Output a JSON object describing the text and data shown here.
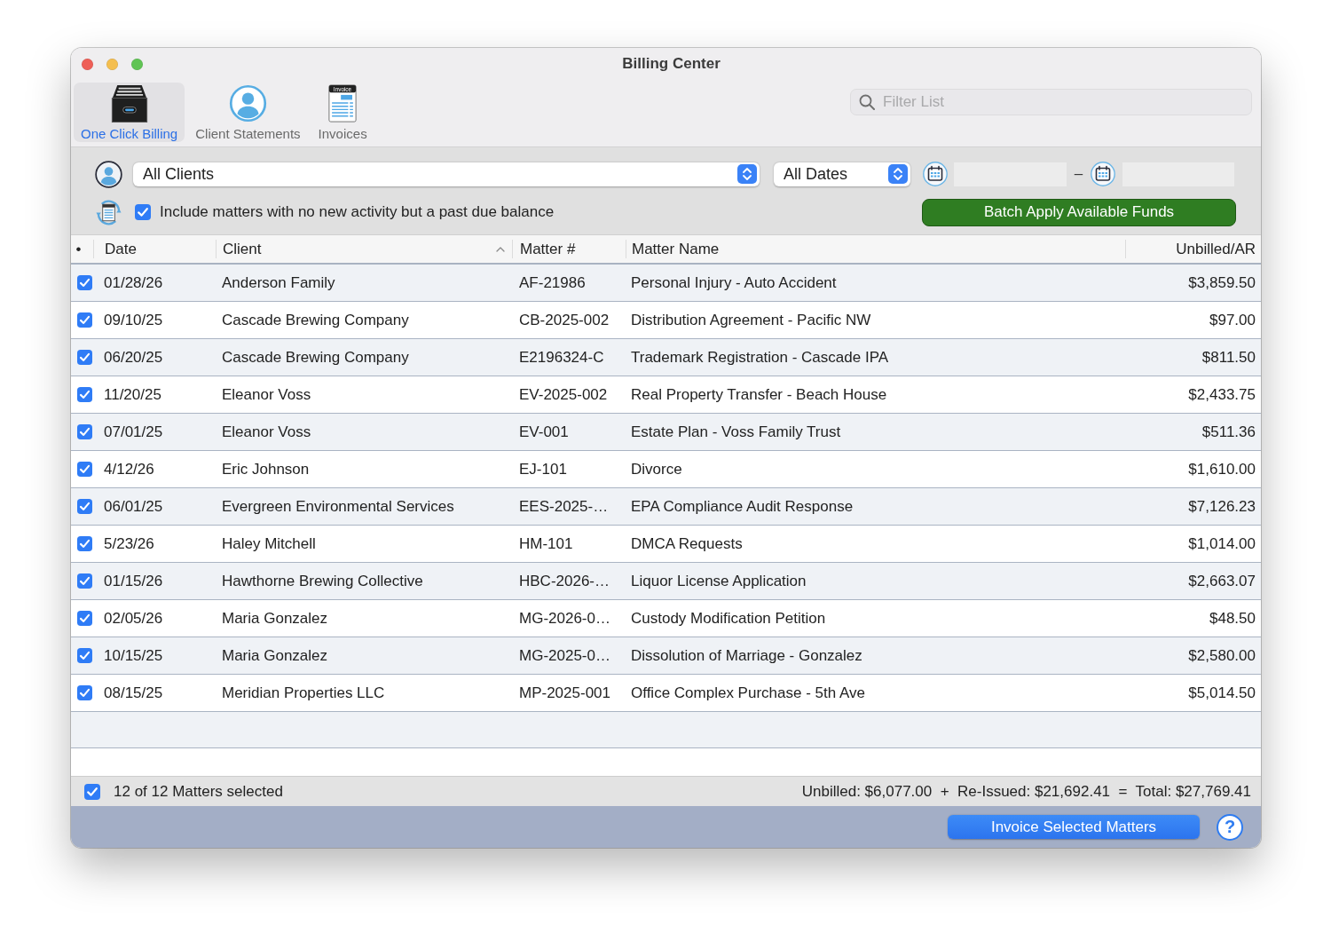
{
  "window": {
    "title": "Billing Center"
  },
  "toolbar": {
    "tabs": [
      {
        "label": "One Click Billing",
        "kind": "drawer",
        "selected": true
      },
      {
        "label": "Client Statements",
        "kind": "person",
        "selected": false
      },
      {
        "label": "Invoices",
        "kind": "invoice",
        "icon_text": "Invoice",
        "selected": false
      }
    ],
    "search": {
      "placeholder": "Filter List"
    }
  },
  "filters": {
    "client_popup": {
      "value": "All Clients"
    },
    "date_popup": {
      "value": "All Dates"
    },
    "date_separator": "–",
    "include_past_due": {
      "label": "Include matters with no new activity but a past due balance",
      "checked": true
    },
    "batch_button": "Batch Apply Available Funds"
  },
  "table": {
    "columns": [
      {
        "label": "•",
        "sorted": false
      },
      {
        "label": "Date",
        "sorted": false
      },
      {
        "label": "Client",
        "sorted": true
      },
      {
        "label": "Matter #",
        "sorted": false
      },
      {
        "label": "Matter Name",
        "sorted": false
      },
      {
        "label": "Unbilled/AR",
        "sorted": false
      }
    ],
    "rows": [
      {
        "checked": true,
        "date": "01/28/26",
        "client": "Anderson Family",
        "matter_number": "AF-21986",
        "matter_name": "Personal Injury - Auto Accident",
        "unbilled_ar": "$3,859.50"
      },
      {
        "checked": true,
        "date": "09/10/25",
        "client": "Cascade Brewing Company",
        "matter_number": "CB-2025-002",
        "matter_name": "Distribution Agreement - Pacific NW",
        "unbilled_ar": "$97.00"
      },
      {
        "checked": true,
        "date": "06/20/25",
        "client": "Cascade Brewing Company",
        "matter_number": "E2196324-C",
        "matter_name": "Trademark Registration - Cascade IPA",
        "unbilled_ar": "$811.50"
      },
      {
        "checked": true,
        "date": "11/20/25",
        "client": "Eleanor Voss",
        "matter_number": "EV-2025-002",
        "matter_name": "Real Property Transfer - Beach House",
        "unbilled_ar": "$2,433.75"
      },
      {
        "checked": true,
        "date": "07/01/25",
        "client": "Eleanor Voss",
        "matter_number": "EV-001",
        "matter_name": "Estate Plan - Voss Family Trust",
        "unbilled_ar": "$511.36"
      },
      {
        "checked": true,
        "date": "4/12/26",
        "client": "Eric Johnson",
        "matter_number": "EJ-101",
        "matter_name": "Divorce",
        "unbilled_ar": "$1,610.00"
      },
      {
        "checked": true,
        "date": "06/01/25",
        "client": "Evergreen Environmental Services",
        "matter_number": "EES-2025-…",
        "matter_name": "EPA Compliance Audit Response",
        "unbilled_ar": "$7,126.23"
      },
      {
        "checked": true,
        "date": "5/23/26",
        "client": "Haley Mitchell",
        "matter_number": "HM-101",
        "matter_name": "DMCA Requests",
        "unbilled_ar": "$1,014.00"
      },
      {
        "checked": true,
        "date": "01/15/26",
        "client": "Hawthorne Brewing Collective",
        "matter_number": "HBC-2026-…",
        "matter_name": "Liquor License Application",
        "unbilled_ar": "$2,663.07"
      },
      {
        "checked": true,
        "date": "02/05/26",
        "client": "Maria Gonzalez",
        "matter_number": "MG-2026-0…",
        "matter_name": "Custody Modification Petition",
        "unbilled_ar": "$48.50"
      },
      {
        "checked": true,
        "date": "10/15/25",
        "client": "Maria Gonzalez",
        "matter_number": "MG-2025-0…",
        "matter_name": "Dissolution of Marriage - Gonzalez",
        "unbilled_ar": "$2,580.00"
      },
      {
        "checked": true,
        "date": "08/15/25",
        "client": "Meridian Properties LLC",
        "matter_number": "MP-2025-001",
        "matter_name": "Office Complex Purchase - 5th Ave",
        "unbilled_ar": "$5,014.50"
      }
    ]
  },
  "status_bar": {
    "all_checked": true,
    "selection": "12 of 12 Matters selected",
    "totals": "Unbilled: $6,077.00  +  Re-Issued: $21,692.41  =  Total: $27,769.41"
  },
  "footer": {
    "invoice_button": "Invoice Selected Matters",
    "help_button": "?"
  }
}
